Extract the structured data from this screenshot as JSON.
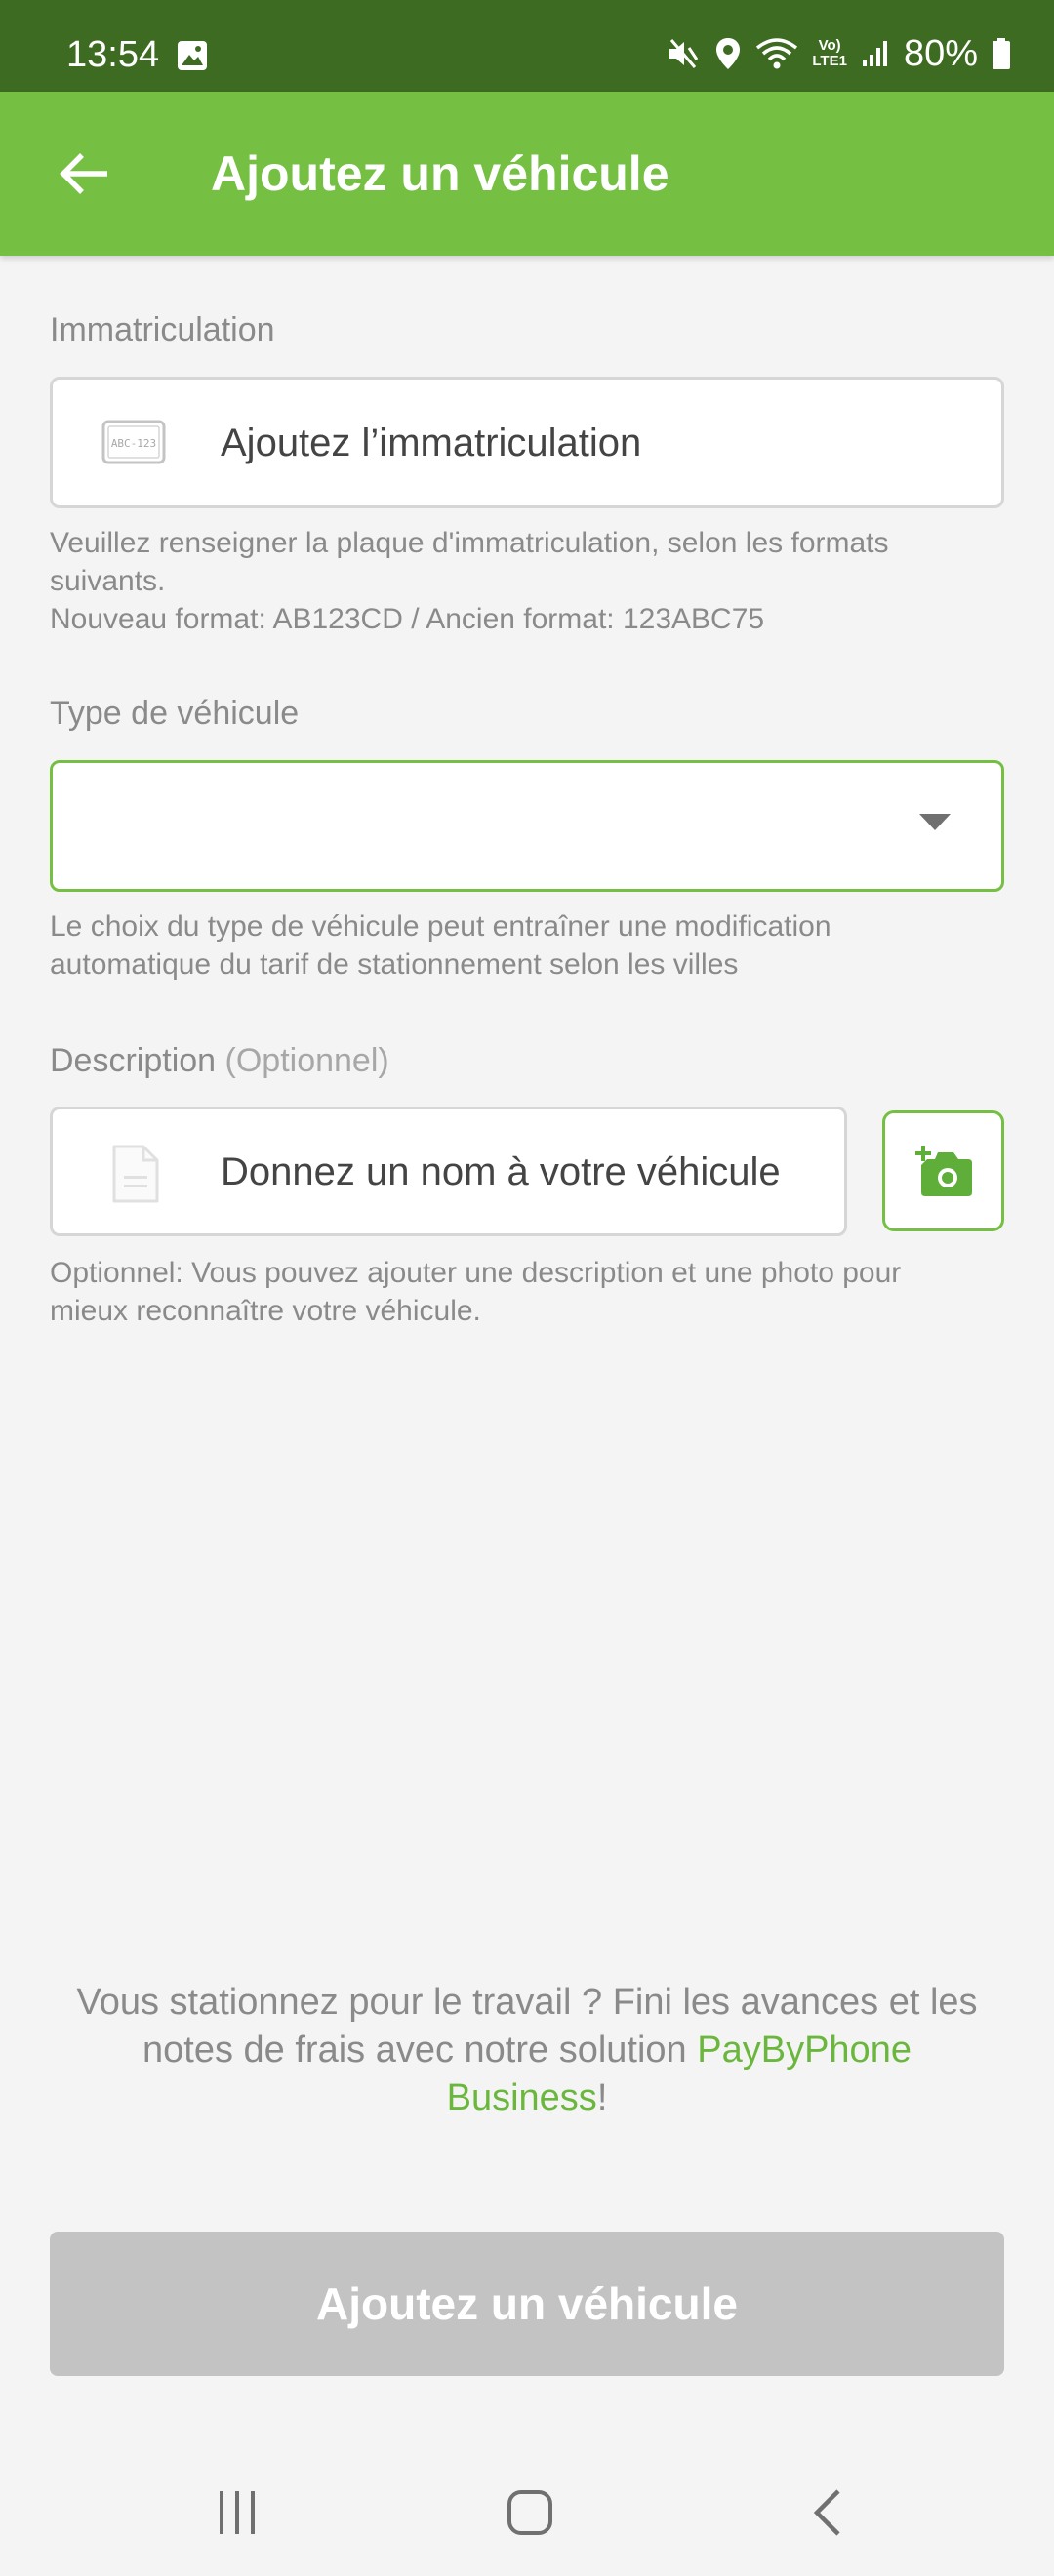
{
  "status_bar": {
    "time": "13:54",
    "battery": "80%",
    "icons": [
      "gallery-icon",
      "mute-icon",
      "location-icon",
      "wifi-icon",
      "volte-icon",
      "signal-icon",
      "battery-icon"
    ],
    "volte_line1": "Vo)",
    "volte_line2": "LTE1"
  },
  "app_bar": {
    "title": "Ajoutez un véhicule",
    "back_icon": "arrow-back-icon",
    "color": "#75c043"
  },
  "form": {
    "plate": {
      "label": "Immatriculation",
      "placeholder": "Ajoutez l’immatriculation",
      "icon": "license-plate-icon",
      "icon_text": "ABC-123",
      "helper_line1": "Veuillez renseigner la plaque d'immatriculation, selon les formats",
      "helper_line2": "suivants.",
      "helper_line3": "Nouveau format: AB123CD / Ancien format: 123ABC75"
    },
    "vehicle_type": {
      "label": "Type de véhicule",
      "value": "",
      "helper_line1": "Le choix du type de véhicule peut entraîner une modification",
      "helper_line2": "automatique du tarif de stationnement selon les villes"
    },
    "description": {
      "label": "Description",
      "label_optional": "(Optionnel)",
      "placeholder": "Donnez un nom à votre véhicule",
      "icon": "document-icon",
      "camera_icon": "add-photo-icon",
      "helper_line1": "Optionnel: Vous pouvez ajouter une description et une photo pour",
      "helper_line2": "mieux reconnaître votre véhicule."
    }
  },
  "promo": {
    "line1": "Vous stationnez pour le travail ? Fini les avances et les",
    "line2_text": "notes de frais avec notre solution ",
    "link_part1": "PayByPhone",
    "link_part2": "Business",
    "suffix": "!"
  },
  "primary_button": {
    "label": "Ajoutez un véhicule"
  },
  "nav": {
    "icons": [
      "recent-apps-icon",
      "home-icon",
      "back-icon"
    ]
  }
}
